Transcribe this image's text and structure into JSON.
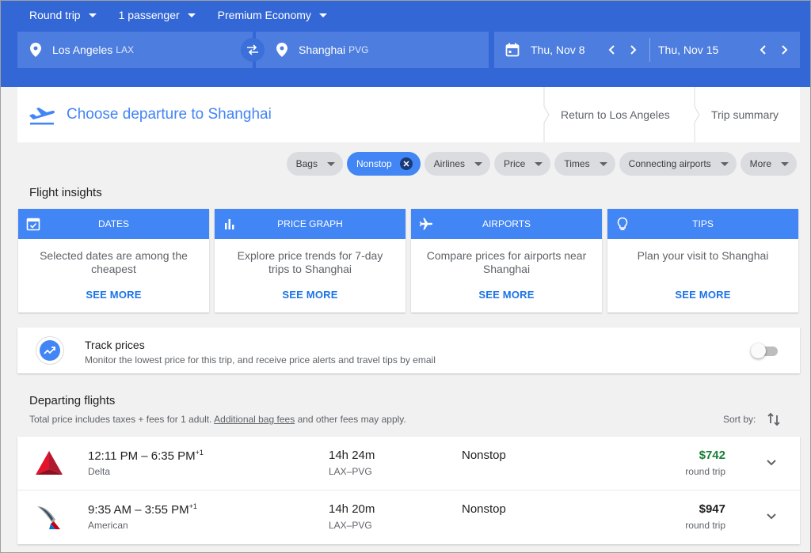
{
  "search": {
    "trip_type": "Round trip",
    "passengers": "1 passenger",
    "cabin": "Premium Economy",
    "origin_city": "Los Angeles",
    "origin_code": "LAX",
    "destination_city": "Shanghai",
    "destination_code": "PVG",
    "depart_date": "Thu, Nov 8",
    "return_date": "Thu, Nov 15"
  },
  "steps": {
    "current": "Choose departure to Shanghai",
    "return": "Return to Los Angeles",
    "summary": "Trip summary"
  },
  "filters": {
    "bags": "Bags",
    "nonstop": "Nonstop",
    "airlines": "Airlines",
    "price": "Price",
    "times": "Times",
    "connecting": "Connecting airports",
    "more": "More"
  },
  "insights": {
    "heading": "Flight insights",
    "see_more": "SEE MORE",
    "cards": [
      {
        "title": "DATES",
        "text": "Selected dates are among the cheapest",
        "icon": "calendar-check-icon"
      },
      {
        "title": "PRICE GRAPH",
        "text": "Explore price trends for 7-day trips to Shanghai",
        "icon": "bar-chart-icon"
      },
      {
        "title": "AIRPORTS",
        "text": "Compare prices for airports near Shanghai",
        "icon": "airplane-icon"
      },
      {
        "title": "TIPS",
        "text": "Plan your visit to Shanghai",
        "icon": "lightbulb-icon"
      }
    ]
  },
  "track": {
    "title": "Track prices",
    "subtitle": "Monitor the lowest price for this trip, and receive price alerts and travel tips by email",
    "enabled": false
  },
  "departing": {
    "heading": "Departing flights",
    "fee_note_pre": "Total price includes taxes + fees for 1 adult.",
    "fee_link": "Additional bag fees",
    "fee_note_post": "and other fees may apply.",
    "sort_label": "Sort by:",
    "flights": [
      {
        "times": "12:11 PM – 6:35 PM",
        "day_offset": "+1",
        "airline": "Delta",
        "duration": "14h 24m",
        "route": "LAX–PVG",
        "stops": "Nonstop",
        "price": "$742",
        "price_note": "round trip"
      },
      {
        "times": "9:35 AM – 3:55 PM",
        "day_offset": "+1",
        "airline": "American",
        "duration": "14h 20m",
        "route": "LAX–PVG",
        "stops": "Nonstop",
        "price": "$947",
        "price_note": "round trip"
      }
    ]
  },
  "colors": {
    "primary": "#3367d6",
    "accent": "#4285f4",
    "field": "#4d7ddf",
    "cheap_price": "#188038"
  }
}
